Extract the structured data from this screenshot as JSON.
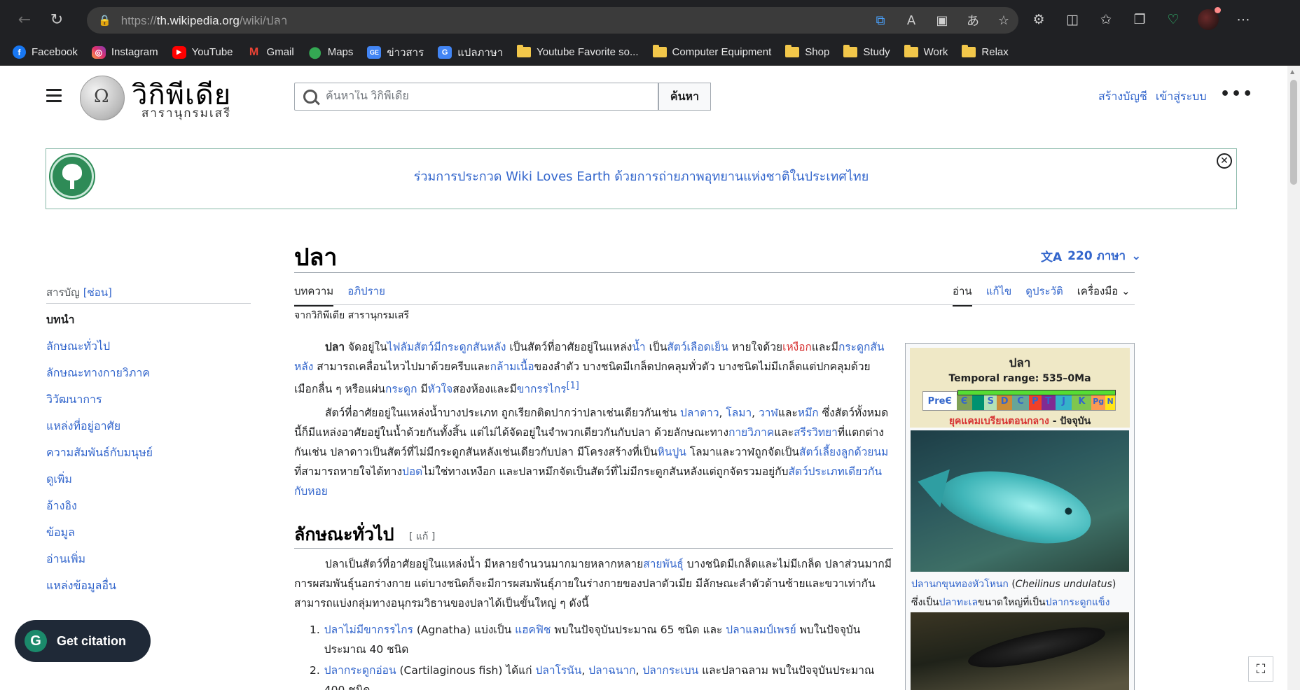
{
  "browser": {
    "url_prefix": "https://",
    "url_host": "th.wikipedia.org",
    "url_path": "/wiki/ปลา",
    "bookmarks": [
      {
        "label": "Facebook",
        "icon": "facebook-icon"
      },
      {
        "label": "Instagram",
        "icon": "instagram-icon"
      },
      {
        "label": "YouTube",
        "icon": "youtube-icon"
      },
      {
        "label": "Gmail",
        "icon": "gmail-icon"
      },
      {
        "label": "Maps",
        "icon": "maps-icon"
      },
      {
        "label": "ข่าวสาร",
        "icon": "google-news-icon"
      },
      {
        "label": "แปลภาษา",
        "icon": "google-translate-icon"
      },
      {
        "label": "Youtube Favorite so...",
        "icon": "folder-icon"
      },
      {
        "label": "Computer Equipment",
        "icon": "folder-icon"
      },
      {
        "label": "Shop",
        "icon": "folder-icon"
      },
      {
        "label": "Study",
        "icon": "folder-icon"
      },
      {
        "label": "Work",
        "icon": "folder-icon"
      },
      {
        "label": "Relax",
        "icon": "folder-icon"
      }
    ]
  },
  "header": {
    "logo_title": "วิกิพีเดีย",
    "logo_subtitle": "สารานุกรมเสรี",
    "search_placeholder": "ค้นหาใน วิกิพีเดีย",
    "search_button": "ค้นหา",
    "create_account": "สร้างบัญชี",
    "login": "เข้าสู่ระบบ",
    "more": "•••"
  },
  "banner": {
    "message": "ร่วมการประกวด Wiki Loves Earth ด้วยการถ่ายภาพอุทยานแห่งชาติในประเทศไทย",
    "close": "✕"
  },
  "article": {
    "title": "ปลา",
    "languages": "220 ภาษา",
    "tab_article": "บทความ",
    "tab_talk": "อภิปราย",
    "tab_read": "อ่าน",
    "tab_edit": "แก้ไข",
    "tab_history": "ดูประวัติ",
    "tab_tools": "เครื่องมือ",
    "tagline": "จากวิกิพีเดีย สารานุกรมเสรี",
    "section1_title": "ลักษณะทั่วไป",
    "section1_edit": "[ แก้ ]"
  },
  "toc": {
    "heading": "สารบัญ",
    "hide": "[ซ่อน]",
    "items": [
      "บทนำ",
      "ลักษณะทั่วไป",
      "ลักษณะทางกายวิภาค",
      "วิวัฒนาการ",
      "แหล่งที่อยู่อาศัย",
      "ความสัมพันธ์กับมนุษย์",
      "ดูเพิ่ม",
      "อ้างอิง",
      "ข้อมูล",
      "อ่านเพิ่ม",
      "แหล่งข้อมูลอื่น"
    ]
  },
  "infobox": {
    "title": "ปลา",
    "temporal_range": "Temporal range: 535–0Ma",
    "periods": [
      "PreЄ",
      "Є",
      "O",
      "S",
      "D",
      "C",
      "P",
      "T",
      "J",
      "K",
      "Pg",
      "N"
    ],
    "era_link": "ยุคแคมเบรียนตอนกลาง",
    "era_rest": " - ปัจจุบัน",
    "caption_link": "ปลานกขุนทองหัวโหนก",
    "caption_sci": "Cheilinus undulatus",
    "caption_2a": "ซึ่งเป็น",
    "caption_2b": "ปลาทะเล",
    "caption_2c": "ขนาดใหญ่ที่เป็น",
    "caption_2d": "ปลากระดูกแข็ง"
  },
  "floating": {
    "cite": "Get citation",
    "fullscreen": "⛶"
  }
}
